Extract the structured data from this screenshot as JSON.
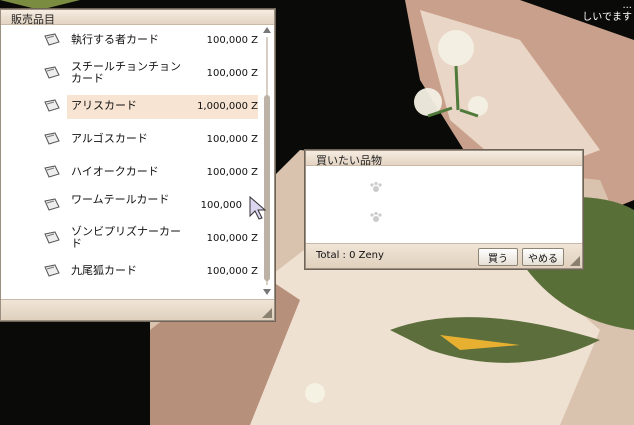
{
  "shop": {
    "title": "販売品目",
    "items": [
      {
        "name": "執行する者カード",
        "price": "100,000 Z",
        "selected": false
      },
      {
        "name": "スチールチョンチョンカード",
        "price": "100,000 Z",
        "selected": false
      },
      {
        "name": "アリスカード",
        "price": "1,000,000 Z",
        "selected": true
      },
      {
        "name": "アルゴスカード",
        "price": "100,000 Z",
        "selected": false
      },
      {
        "name": "ハイオークカード",
        "price": "100,000 Z",
        "selected": false
      },
      {
        "name": "ワームテールカード",
        "price": "100,000",
        "selected": false
      },
      {
        "name": "ゾンビプリズナーカード",
        "price": "100,000 Z",
        "selected": false
      },
      {
        "name": "九尾狐カード",
        "price": "100,000 Z",
        "selected": false
      }
    ]
  },
  "cart": {
    "title": "買いたい品物",
    "total": "Total : 0 Zeny",
    "buy_label": "買う",
    "cancel_label": "やめる",
    "slots": 2
  },
  "corner_text": [
    "...",
    "しいでます"
  ],
  "colors": {
    "accent": "#f7e4d2",
    "frame": "#e3d4c3"
  }
}
